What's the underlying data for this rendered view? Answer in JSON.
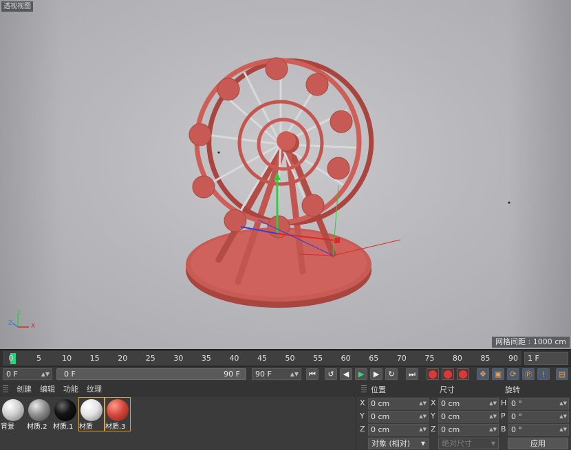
{
  "viewport": {
    "title": "透视视图",
    "grid_spacing": "网格间距 : 1000 cm",
    "axis_labels": {
      "y": "Y",
      "z": "Z",
      "x": "X"
    },
    "model_color": "#c85a55",
    "background_color": "#bdbdc1"
  },
  "timeline": {
    "ticks": [
      "0",
      "5",
      "10",
      "15",
      "20",
      "25",
      "30",
      "35",
      "40",
      "45",
      "50",
      "55",
      "60",
      "65",
      "70",
      "75",
      "80",
      "85",
      "90"
    ],
    "current_frame": "1 F",
    "playhead_color": "#28d37a"
  },
  "transport": {
    "start_field": "0 F",
    "range_start": "0 F",
    "range_end": "90 F",
    "end_field": "90 F",
    "buttons": [
      "go-to-start-icon",
      "prev-key-icon",
      "step-back-icon",
      "play-icon",
      "step-forward-icon",
      "next-key-icon",
      "go-to-end-icon",
      "record-icon",
      "autokey-icon",
      "keyframe-selection-icon",
      "move-key-icon",
      "scale-key-icon",
      "rotate-key-icon",
      "param-key-icon",
      "pla-key-icon",
      "timeline-icon"
    ]
  },
  "materials": {
    "menu": [
      "创建",
      "编辑",
      "功能",
      "纹理"
    ],
    "items": [
      {
        "name": "背景",
        "color": "#d8d8d8",
        "selected": false
      },
      {
        "name": "材质.2",
        "color": "#9a9a9a",
        "selected": false
      },
      {
        "name": "材质.1",
        "color": "#111111",
        "selected": false
      },
      {
        "name": "材质",
        "color": "#e6e6e6",
        "selected": true
      },
      {
        "name": "材质.3",
        "color": "#d24a3e",
        "selected": true
      }
    ]
  },
  "coordinates": {
    "headers": {
      "position": "位置",
      "size": "尺寸",
      "rotation": "旋转"
    },
    "rows": [
      {
        "axis": "X",
        "pos": "0 cm",
        "size_axis": "X",
        "size": "0 cm",
        "rot_axis": "H",
        "rot": "0 °"
      },
      {
        "axis": "Y",
        "pos": "0 cm",
        "size_axis": "Y",
        "size": "0 cm",
        "rot_axis": "P",
        "rot": "0 °"
      },
      {
        "axis": "Z",
        "pos": "0 cm",
        "size_axis": "Z",
        "size": "0 cm",
        "rot_axis": "B",
        "rot": "0 °"
      }
    ],
    "mode": "对象 (相对)",
    "size_mode": "绝对尺寸",
    "apply": "应用"
  }
}
